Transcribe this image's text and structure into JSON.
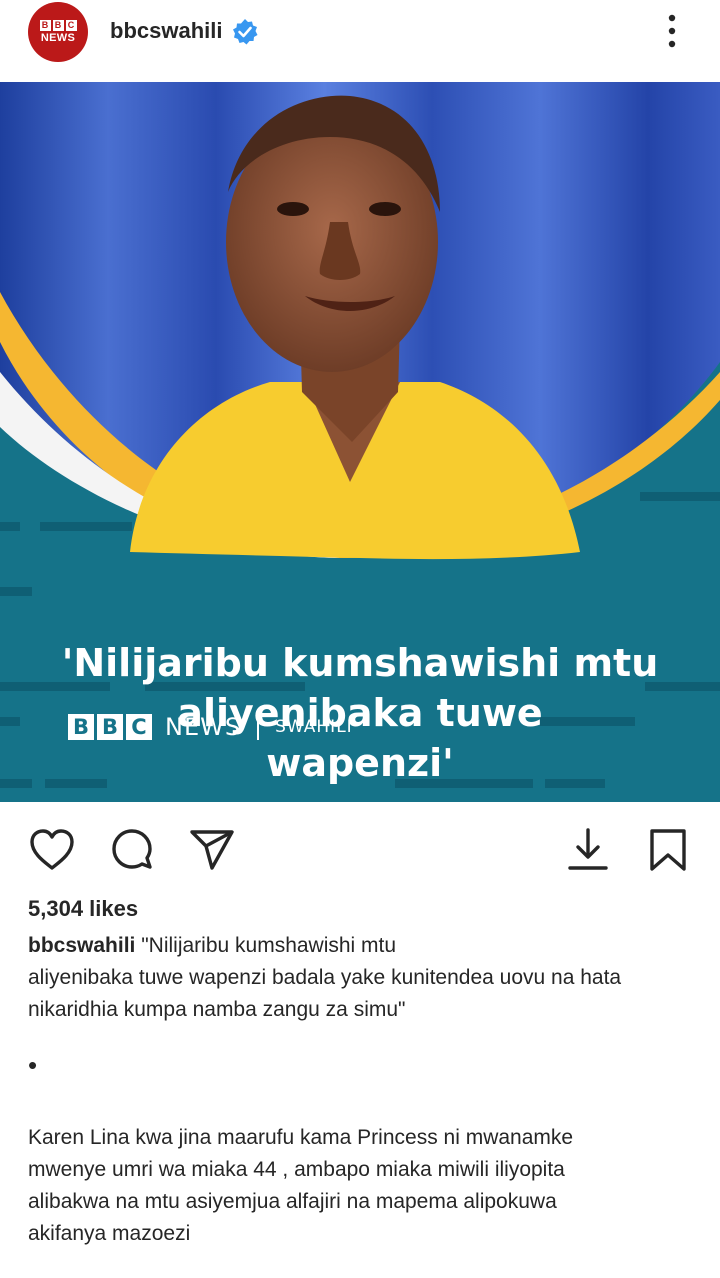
{
  "header": {
    "avatar": {
      "bbc_letters": [
        "B",
        "B",
        "C"
      ],
      "news_label": "NEWS"
    },
    "username": "bbcswahili",
    "verified_icon": "verified-badge-icon",
    "more_icon": "vertical-ellipsis-icon"
  },
  "media": {
    "headline_lines": [
      "'Nilijaribu kumshawishi mtu",
      "aliyenibaka tuwe",
      "wapenzi'"
    ],
    "brand": {
      "bbc_letters": [
        "B",
        "B",
        "C"
      ],
      "news": "NEWS",
      "service": "SWAHILI"
    },
    "colors": {
      "panel": "#157389",
      "accent_yellow": "#f5b731",
      "backdrop_blue": "#2b4fb3",
      "shirt_yellow": "#f7cc2f"
    }
  },
  "actions": {
    "like_icon": "heart-icon",
    "comment_icon": "comment-icon",
    "share_icon": "send-icon",
    "download_icon": "download-icon",
    "save_icon": "bookmark-icon"
  },
  "post": {
    "likes": "5,304 likes",
    "caption_user": "bbcswahili",
    "caption_lines": [
      "\"Nilijaribu kumshawishi mtu",
      "aliyenibaka tuwe wapenzi  badala yake kunitendea uovu na hata",
      "nikaridhia kumpa namba zangu za simu\""
    ],
    "bullet": "•",
    "paragraph_lines": [
      "Karen Lina kwa jina maarufu kama Princess ni mwanamke",
      "mwenye umri wa miaka 44 , ambapo miaka miwili iliyopita",
      "alibakwa na mtu asiyemjua alfajiri na mapema alipokuwa",
      "akifanya mazoezi"
    ]
  }
}
